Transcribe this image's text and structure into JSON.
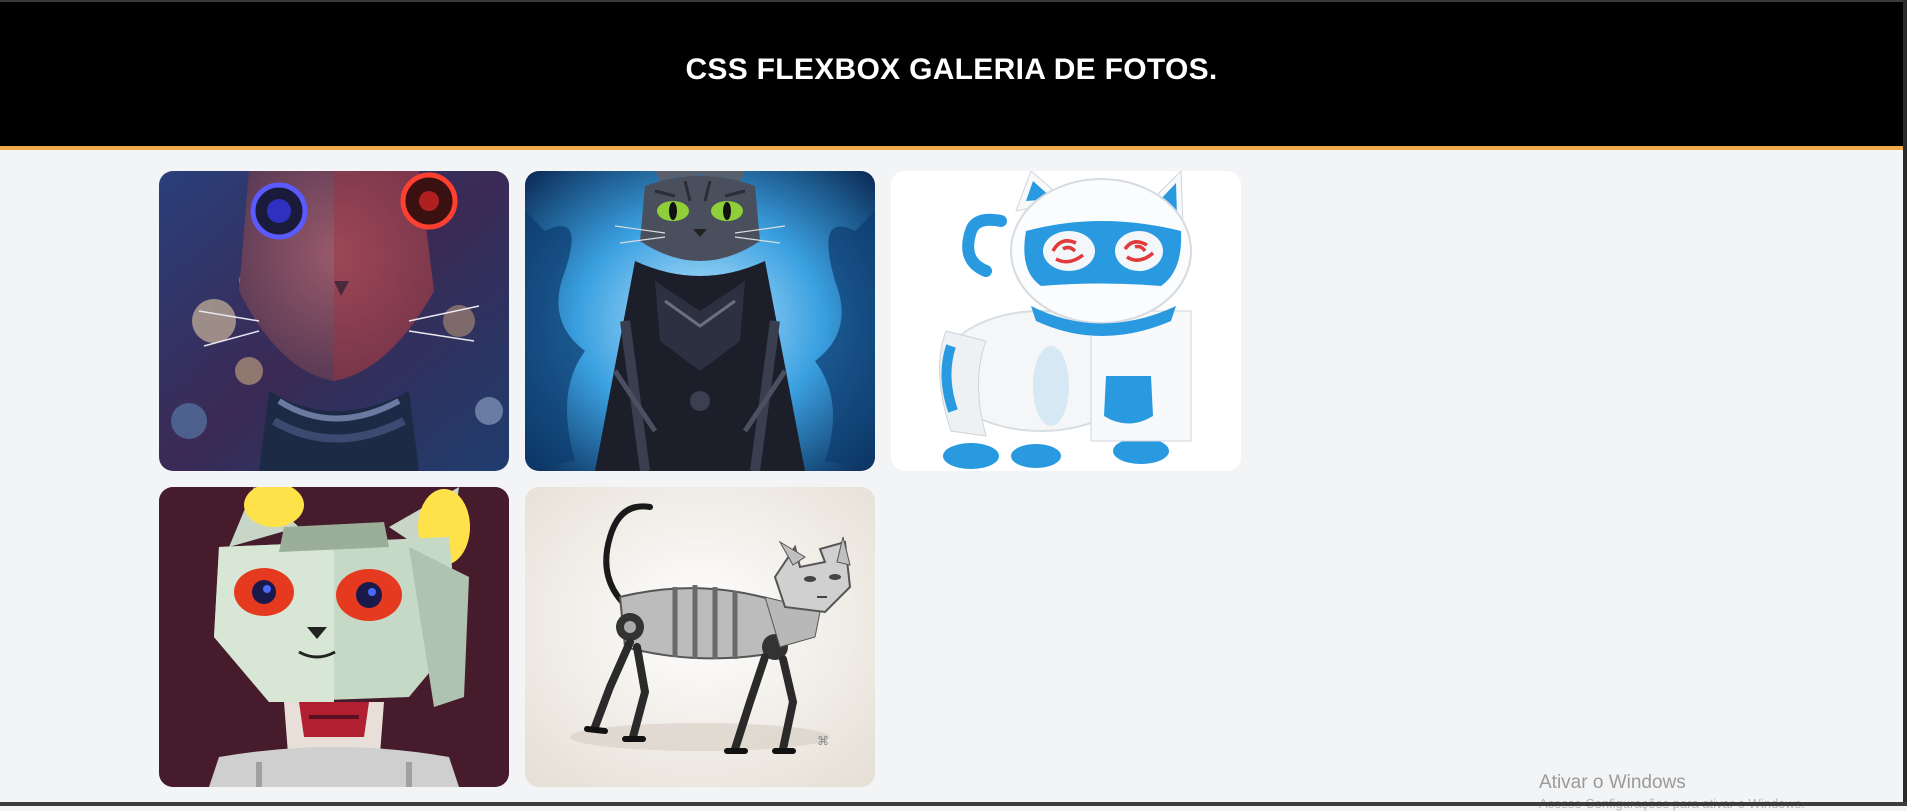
{
  "header": {
    "title": "CSS FLEXBOX GALERIA DE FOTOS."
  },
  "gallery": {
    "photos": [
      {
        "subject": "cyborg cat with glowing red and blue eyes"
      },
      {
        "subject": "armored dark cat with blue flames"
      },
      {
        "subject": "white and blue robot toy cat"
      },
      {
        "subject": "low-poly robot cat with red eyes"
      },
      {
        "subject": "mechanical robot cat walking"
      }
    ]
  },
  "system": {
    "watermark_title": "Ativar o Windows",
    "watermark_subtitle": "Acesse Configurações para ativar o Windows."
  },
  "colors": {
    "header_bg": "#000000",
    "header_border": "#f0a94a",
    "page_bg": "#f3f4f6"
  }
}
